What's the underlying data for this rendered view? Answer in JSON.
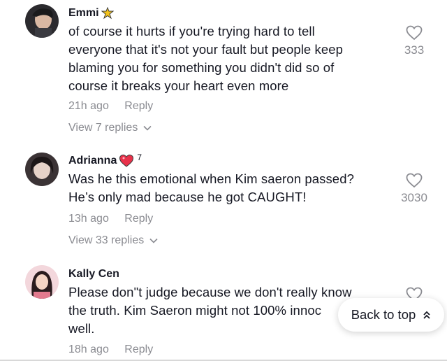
{
  "comments": [
    {
      "username": "Emmi",
      "badge": "star-badge-icon",
      "text_lines": [
        "of course it hurts if you're trying hard to tell",
        "everyone that it's not your fault but people keep",
        "blaming you for something you didn't did so of",
        "course it breaks your heart even more"
      ],
      "time": "21h ago",
      "reply_label": "Reply",
      "view_replies": "View 7 replies",
      "likes": "333"
    },
    {
      "username": "Adrianna",
      "badge": "heart-badge-icon",
      "badge_count": "7",
      "text_lines": [
        "Was he this emotional when Kim saeron passed?",
        "He’s only mad because he got CAUGHT!"
      ],
      "time": "13h ago",
      "reply_label": "Reply",
      "view_replies": "View 33 replies",
      "likes": "3030"
    },
    {
      "username": "Kally Cen",
      "text_lines": [
        "Please don\"t judge because we don't really know",
        "the truth. Kim Saeron might not 100% innoc",
        "well."
      ],
      "time": "18h ago",
      "reply_label": "Reply"
    }
  ],
  "back_to_top": "Back to top",
  "colors": {
    "text": "#161823",
    "muted": "#8a8b91",
    "heart_badge": "#e8314a",
    "star_badge": "#f3c21b"
  }
}
